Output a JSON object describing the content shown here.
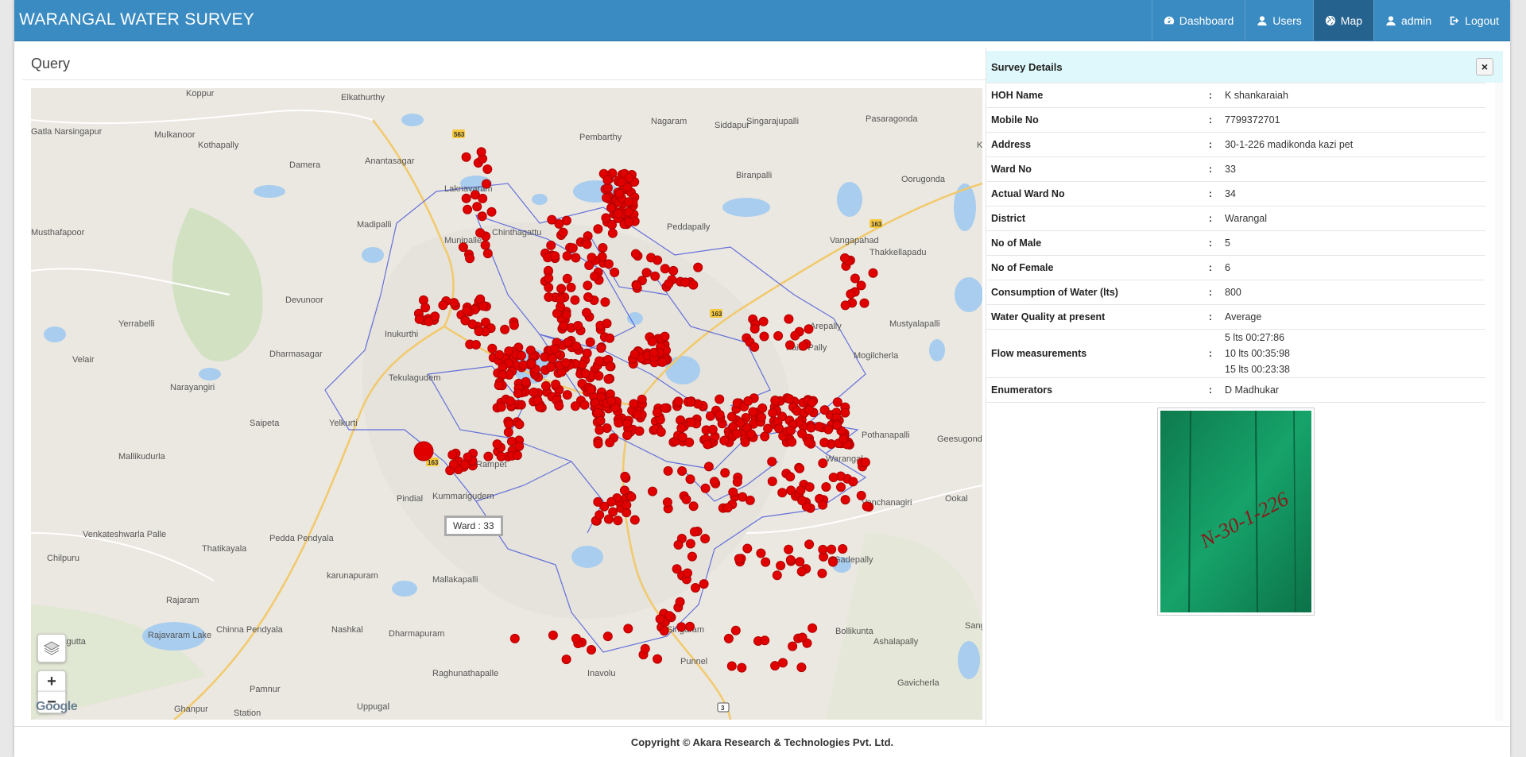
{
  "app": {
    "title": "WARANGAL WATER SURVEY"
  },
  "nav": {
    "items": [
      {
        "label": "Dashboard",
        "icon": "dashboard-icon",
        "active": false
      },
      {
        "label": "Users",
        "icon": "user-icon",
        "active": false
      },
      {
        "label": "Map",
        "icon": "globe-icon",
        "active": true
      },
      {
        "label": "admin",
        "icon": "user-icon",
        "active": false
      },
      {
        "label": "Logout",
        "icon": "logout-icon",
        "active": false
      }
    ]
  },
  "query": {
    "title": "Query"
  },
  "map": {
    "ward_tooltip": "Ward : 33",
    "zoom_in": "+",
    "zoom_out": "−",
    "google_logo": "Google",
    "marker_color": "#e00000",
    "places": [
      "Koppur",
      "Elkathurthy",
      "Pembarthy",
      "Nagaram",
      "Siddapur",
      "Singarajupalli",
      "Pasaragonda",
      "Kogilvai",
      "Gatla Narsingapur",
      "Mulkanoor",
      "Kothapally",
      "Anantasagar",
      "Damera",
      "Laknavaram",
      "Biranpalli",
      "Oorugonda",
      "Musthafapoor",
      "Madipalli",
      "Munipalle",
      "Chinthagattu",
      "Peddapally",
      "Vangapahad",
      "Thakkellapadu",
      "Devunoor",
      "Yerrabelli",
      "Arepally",
      "Mustyalapalli",
      "Velair",
      "Dharmasagar",
      "Tekulagudem",
      "Inukurthi",
      "Paidi Pally",
      "Mogilcherla",
      "Narayangiri",
      "Saipeta",
      "Yelkurti",
      "Pothanapalli",
      "Geesugonda",
      "Mallikudurla",
      "Rampet",
      "Warangal",
      "Vanchanagiri",
      "Ookal",
      "Pindial",
      "Kummarigudem",
      "Pedda Pendyala",
      "Venkateshwarla Palle",
      "Thatikayala",
      "Chilpuru",
      "karunapuram",
      "Mallakapalli",
      "Gadepally",
      "Rajaram",
      "Chinna Pendyala",
      "Nashkal",
      "Dharmapuram",
      "Singaram",
      "Bollikunta",
      "Ashalapally",
      "Sangem",
      "Pallagutta",
      "Rajavaram Lake",
      "Raghunathapalle",
      "Inavolu",
      "Punnel",
      "Gavicherla",
      "Ghanpur",
      "Pamnur",
      "Uppugal",
      "Station"
    ]
  },
  "survey": {
    "title": "Survey Details",
    "close": "×",
    "rows": [
      {
        "label": "HOH Name",
        "value": "K shankaraiah"
      },
      {
        "label": "Mobile No",
        "value": "7799372701"
      },
      {
        "label": "Address",
        "value": "30-1-226 madikonda kazi pet"
      },
      {
        "label": "Ward No",
        "value": "33"
      },
      {
        "label": "Actual Ward No",
        "value": "34"
      },
      {
        "label": "District",
        "value": "Warangal"
      },
      {
        "label": "No of Male",
        "value": "5"
      },
      {
        "label": "No of Female",
        "value": "6"
      },
      {
        "label": "Consumption of Water (lts)",
        "value": "800"
      },
      {
        "label": "Water Quality at present",
        "value": "Average"
      }
    ],
    "flow_label": "Flow measurements",
    "flow_values": [
      "5 lts 00:27:86",
      "10 lts 00:35:98",
      "15 lts 00:23:38"
    ],
    "enumerator_label": "Enumerators",
    "enumerator_value": "D Madhukar",
    "separator": ":",
    "photo_text": "N-30-1-226"
  },
  "footer": {
    "text": "Copyright © Akara Research & Technologies Pvt. Ltd."
  }
}
